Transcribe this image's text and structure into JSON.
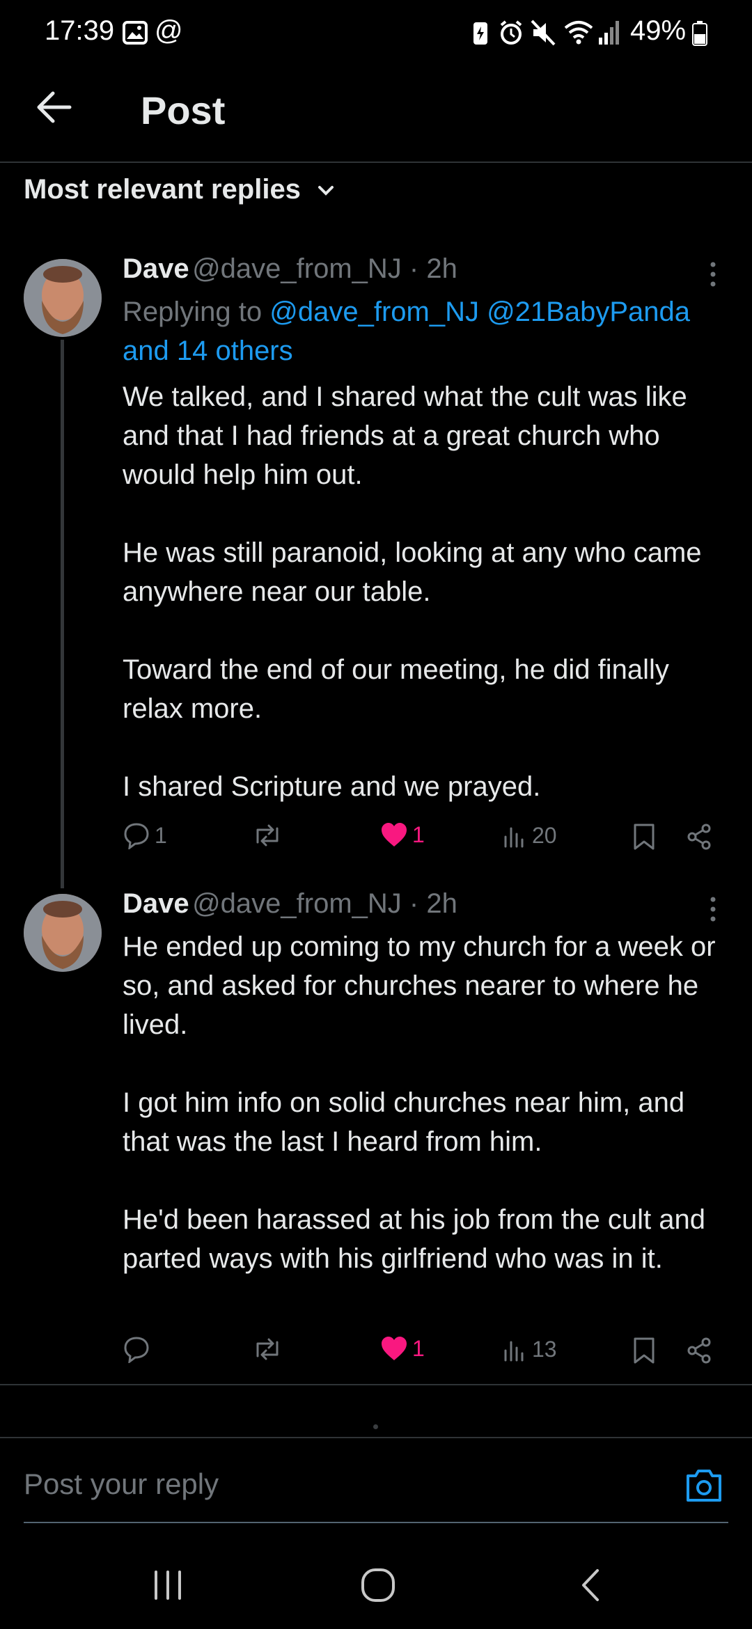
{
  "status_bar": {
    "time": "17:39",
    "battery": "49%"
  },
  "header": {
    "title": "Post"
  },
  "sort": {
    "label": "Most relevant replies"
  },
  "tweets": [
    {
      "name": "Dave",
      "handle": "@dave_from_NJ · 2h",
      "replying_prefix": "Replying to ",
      "replying_links": "@dave_from_NJ @21BabyPanda",
      "replying_more": "and 14 others",
      "text": "We talked, and I shared what the cult was like and that I had friends at a great church who would help him out.\n\nHe was still paranoid, looking at any who came anywhere near our table.\n\nToward the end of our meeting, he did finally relax more.\n\nI shared Scripture and we prayed.",
      "replies": "1",
      "likes": "1",
      "views": "20"
    },
    {
      "name": "Dave",
      "handle": "@dave_from_NJ · 2h",
      "text": "He ended up coming to my church for a week or so, and asked for churches nearer to where he lived.\n\nI got him info on solid churches near him, and that was the last I heard from him.\n\nHe'd been harassed at his job from the cult and parted ways with his girlfriend who was in it.",
      "likes": "1",
      "views": "13"
    }
  ],
  "reply_box": {
    "placeholder": "Post your reply"
  },
  "colors": {
    "accent": "#1d9bf0",
    "like": "#f91880",
    "muted": "#71767b",
    "background": "#000000"
  }
}
